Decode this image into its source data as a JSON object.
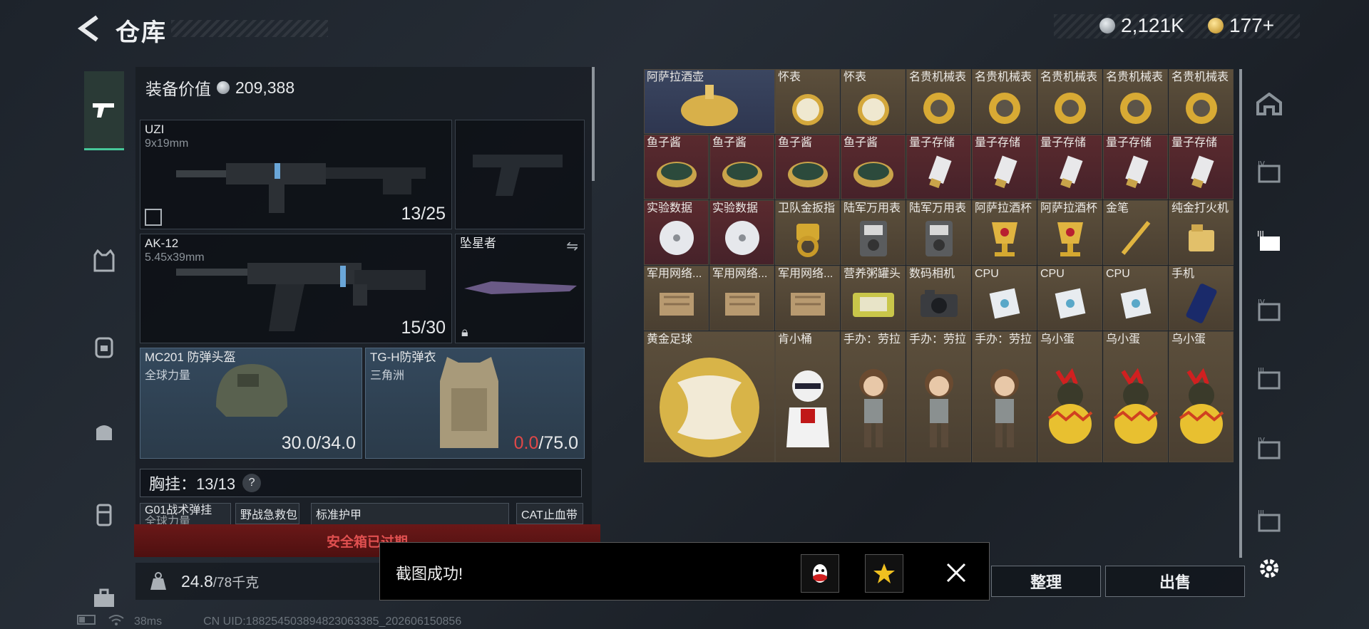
{
  "header": {
    "back_icon": "back-arrow-icon",
    "title": "仓库"
  },
  "currency": {
    "silver": "2,121K",
    "gold": "177+"
  },
  "equipment": {
    "value_label": "装备价值",
    "value": "209,388",
    "primary": {
      "name": "UZI",
      "ammo": "9x19mm",
      "count": "13/25"
    },
    "secondary": {
      "name": "AK-12",
      "ammo": "5.45x39mm",
      "count": "15/30"
    },
    "melee": {
      "name": "坠星者"
    },
    "helmet": {
      "name": "MC201 防弹头盔",
      "sub": "全球力量",
      "cur": "30.0",
      "max": "/34.0"
    },
    "vest": {
      "name": "TG-H防弹衣",
      "sub": "三角洲",
      "cur": "0.0",
      "max": "/75.0"
    },
    "chest": {
      "label": "胸挂：13/13",
      "help": "?"
    },
    "mini_items": [
      "G01战术弹挂",
      "野战急救包",
      "标准护甲",
      "CAT止血带"
    ],
    "mini_sub": "全球力量",
    "safe_box": "安全箱已过期",
    "weight": {
      "cur": "24.8",
      "max": "/78千克"
    }
  },
  "stash": {
    "rows": [
      [
        "阿萨拉酒壶",
        "怀表",
        "怀表",
        "名贵机械表",
        "名贵机械表",
        "名贵机械表",
        "名贵机械表",
        "名贵机械表"
      ],
      [
        "鱼子酱",
        "鱼子酱",
        "鱼子酱",
        "鱼子酱",
        "量子存储",
        "量子存储",
        "量子存储",
        "量子存储",
        "量子存储"
      ],
      [
        "实验数据",
        "实验数据",
        "卫队金扳指",
        "陆军万用表",
        "陆军万用表",
        "阿萨拉酒杯",
        "阿萨拉酒杯",
        "金笔",
        "纯金打火机"
      ],
      [
        "军用网络...",
        "军用网络...",
        "军用网络...",
        "营养粥罐头",
        "数码相机",
        "CPU",
        "CPU",
        "CPU",
        "手机"
      ],
      [
        "黄金足球",
        "肯小桶",
        "手办：劳拉",
        "手办：劳拉",
        "手办：劳拉",
        "乌小蛋",
        "乌小蛋",
        "乌小蛋"
      ]
    ]
  },
  "buttons": {
    "sort": "整理",
    "sell": "出售"
  },
  "toast": {
    "message": "截图成功!"
  },
  "status": {
    "ping": "38ms",
    "uid": "CN UID:18825450389482306338­5_202606150856"
  },
  "colors": {
    "accent": "#47c79a",
    "danger": "#e04848",
    "rare_red": "#5a2a2e",
    "rare_gold": "#5c4f3c",
    "rare_blue": "#3b4660"
  }
}
